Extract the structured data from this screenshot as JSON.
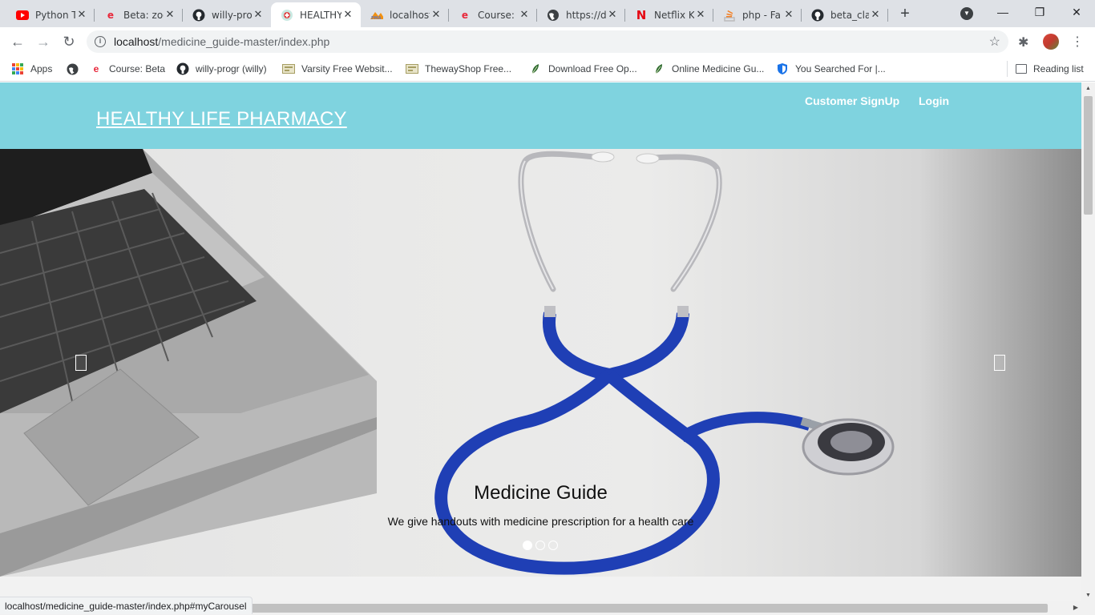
{
  "browser": {
    "tabs": [
      {
        "title": "Python T",
        "icon": "youtube-icon"
      },
      {
        "title": "Beta: zoo",
        "icon": "edge-e-icon"
      },
      {
        "title": "willy-prog",
        "icon": "github-icon"
      },
      {
        "title": "HEALTHY",
        "icon": "site-favicon-icon"
      },
      {
        "title": "localhost",
        "icon": "phpmyadmin-icon"
      },
      {
        "title": "Course: B",
        "icon": "edge-e-icon"
      },
      {
        "title": "https://d",
        "icon": "globe-icon"
      },
      {
        "title": "Netflix K",
        "icon": "netflix-icon"
      },
      {
        "title": "php - Fa",
        "icon": "stackoverflow-icon"
      },
      {
        "title": "beta_cla",
        "icon": "github-icon"
      }
    ],
    "active_tab_index": 3,
    "new_tab_symbol": "+",
    "address": {
      "host": "localhost",
      "path": "/medicine_guide-master/index.php"
    },
    "bookmarks": [
      {
        "label": "Apps",
        "icon": "apps-grid-icon"
      },
      {
        "label": "",
        "icon": "globe-icon"
      },
      {
        "label": "Course: Beta",
        "icon": "edge-e-icon"
      },
      {
        "label": "willy-progr (willy)",
        "icon": "github-icon"
      },
      {
        "label": "Varsity Free Websit...",
        "icon": "template-icon"
      },
      {
        "label": "ThewayShop Free...",
        "icon": "template-icon"
      },
      {
        "label": "Download Free Op...",
        "icon": "leaf-icon"
      },
      {
        "label": "Online Medicine Gu...",
        "icon": "leaf-icon"
      },
      {
        "label": "You Searched For |...",
        "icon": "shield-icon"
      }
    ],
    "reading_list": "Reading list",
    "status_url": "localhost/medicine_guide-master/index.php#myCarousel"
  },
  "site": {
    "brand": "HEALTHY LIFE PHARMACY",
    "nav": [
      {
        "label": "Customer SignUp"
      },
      {
        "label": "Login"
      }
    ],
    "colors": {
      "header": "#7fd3df",
      "stethoscope_tube": "#1f3fb5"
    },
    "carousel": {
      "title": "Medicine Guide",
      "text": "We give handouts with medicine prescription for a health care",
      "slides": 3,
      "active_slide": 1
    }
  }
}
